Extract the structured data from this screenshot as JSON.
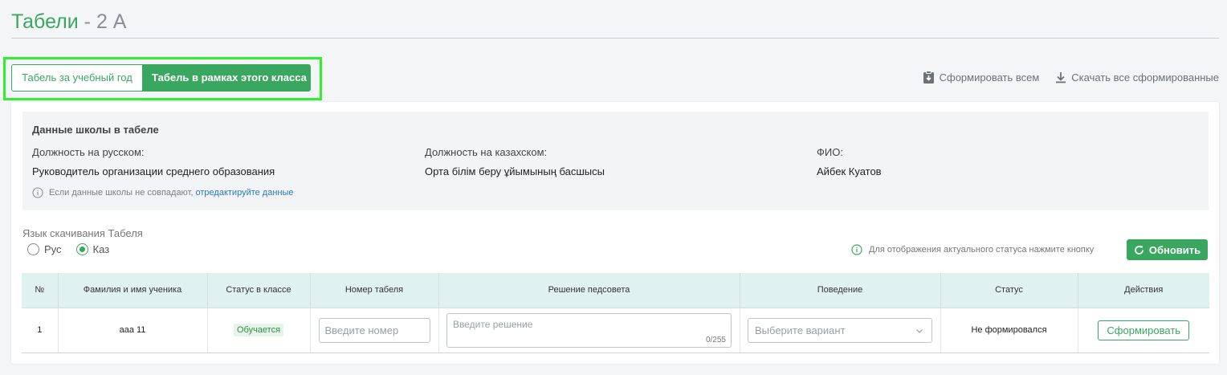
{
  "header": {
    "title": "Табели",
    "separator": " - ",
    "class_name": "2 А"
  },
  "tabs": [
    {
      "label": "Табель за учебный год",
      "active": false
    },
    {
      "label": "Табель в рамках этого класса",
      "active": true
    }
  ],
  "actions": {
    "generate_all": "Сформировать всем",
    "download_all": "Скачать все сформированные"
  },
  "school_data": {
    "title": "Данные школы в табеле",
    "position_ru_label": "Должность на русском:",
    "position_ru_value": "Руководитель организации среднего образования",
    "position_kz_label": "Должность на казахском:",
    "position_kz_value": "Орта білім беру ұйымының басшысы",
    "fio_label": "ФИО:",
    "fio_value": "Айбек Куатов",
    "note_text": "Если данные школы не совпадают,",
    "note_link": "отредактируйте данные"
  },
  "language": {
    "label": "Язык скачивания Табеля",
    "options": [
      {
        "label": "Рус",
        "checked": false
      },
      {
        "label": "Каз",
        "checked": true
      }
    ]
  },
  "refresh": {
    "hint": "Для отображения актуального статуса нажмите кнопку",
    "button": "Обновить"
  },
  "table": {
    "columns": [
      "№",
      "Фамилия и имя ученика",
      "Статус в классе",
      "Номер табеля",
      "Решение педсовета",
      "Поведение",
      "Статус",
      "Действия"
    ],
    "rows": [
      {
        "num": "1",
        "name": "ааа 11",
        "class_status": "Обучается",
        "number_placeholder": "Введите номер",
        "decision_placeholder": "Введите решение",
        "decision_counter": "0/255",
        "behavior_placeholder": "Выберите вариант",
        "status": "Не формировался",
        "action": "Сформировать"
      }
    ]
  },
  "colors": {
    "accent": "#3aa760",
    "highlight": "#2ef02e",
    "table_header": "#e0f2ef"
  }
}
